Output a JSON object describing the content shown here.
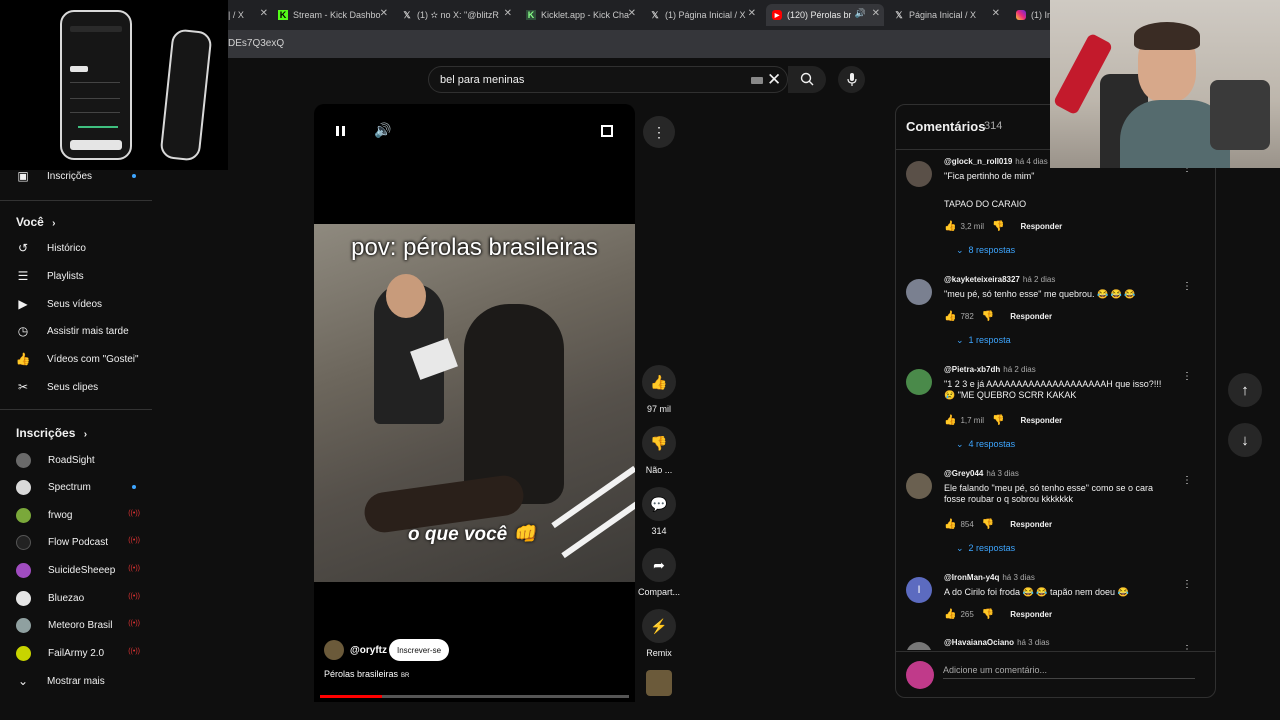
{
  "browser": {
    "tabs": [
      {
        "title": "| / X",
        "favicon": "x-icon",
        "active": false
      },
      {
        "title": "Stream - Kick Dashbo",
        "favicon": "kick-icon",
        "active": false
      },
      {
        "title": "(1) ✫ no X: \"@blitzR",
        "favicon": "x-icon",
        "active": false
      },
      {
        "title": "Kicklet.app - Kick Cha",
        "favicon": "kicklet-icon",
        "active": false
      },
      {
        "title": "(1) Página Inicial / X",
        "favicon": "x-icon",
        "active": false
      },
      {
        "title": "(120) Pérolas bra",
        "favicon": "youtube-icon",
        "active": true
      },
      {
        "title": "Página Inicial / X",
        "favicon": "x-icon",
        "active": false
      },
      {
        "title": "(1) In",
        "favicon": "instagram-icon",
        "active": false
      }
    ],
    "url_fragment": "DEs7Q3exQ"
  },
  "search": {
    "value": "bel para meninas"
  },
  "sidebar": {
    "top_item": "Inscrições",
    "voce_section": "Você",
    "voce_items": [
      {
        "label": "Histórico",
        "icon": "history-icon"
      },
      {
        "label": "Playlists",
        "icon": "playlist-icon"
      },
      {
        "label": "Seus vídeos",
        "icon": "my-videos-icon"
      },
      {
        "label": "Assistir mais tarde",
        "icon": "clock-icon"
      },
      {
        "label": "Vídeos com \"Gostei\"",
        "icon": "thumb-up-icon"
      },
      {
        "label": "Seus clipes",
        "icon": "scissors-icon"
      }
    ],
    "subs_section": "Inscrições",
    "subscriptions": [
      {
        "name": "RoadSight",
        "color": "#6a6a6a",
        "indicator": ""
      },
      {
        "name": "Spectrum",
        "color": "#d9d9d9",
        "indicator": "new"
      },
      {
        "name": "frwog",
        "color": "#7aa83a",
        "indicator": "live"
      },
      {
        "name": "Flow Podcast",
        "color": "#222222",
        "indicator": "live"
      },
      {
        "name": "SuicideSheeep",
        "color": "#a04cc0",
        "indicator": "live"
      },
      {
        "name": "Bluezao",
        "color": "#e5e5e5",
        "indicator": "live"
      },
      {
        "name": "Meteoro Brasil",
        "color": "#8fa0a0",
        "indicator": "live"
      },
      {
        "name": "FailArmy 2.0",
        "color": "#c8d400",
        "indicator": "live"
      }
    ],
    "show_more": "Mostrar mais"
  },
  "video": {
    "caption_top": "pov: pérolas brasileiras",
    "caption_bottom": "o que você 👊",
    "channel": "@oryftz",
    "subscribe_label": "Inscrever-se",
    "title": "Pérolas brasileiras",
    "title_badge": "BR",
    "progress": 0.2
  },
  "actions": {
    "like_count": "97 mil",
    "dislike_label": "Não ...",
    "comments_count": "314",
    "share_label": "Compart...",
    "remix_label": "Remix"
  },
  "comments_panel": {
    "title": "Comentários",
    "count": "314",
    "reply_label": "Responder",
    "input_placeholder": "Adicione um comentário...",
    "items": [
      {
        "author": "@glock_n_roll019",
        "time": "há 4 dias",
        "text": "\"Fica pertinho de mim\"",
        "text2": "TAPAO DO CARAIO",
        "likes": "3,2 mil",
        "replies": "8 respostas",
        "avatar_color": "#5a5048"
      },
      {
        "author": "@kayketeixeira8327",
        "time": "há 2 dias",
        "text": "\"meu pé, só tenho esse\" me quebrou. 😂 😂 😂",
        "text2": "",
        "likes": "782",
        "replies": "1 resposta",
        "avatar_color": "#7a8090"
      },
      {
        "author": "@Pietra-xb7dh",
        "time": "há 2 dias",
        "text": "\"1 2 3 e já AAAAAAAAAAAAAAAAAAAAH que isso?!!! 😢 \"ME QUEBRO SCRR KAKAK",
        "text2": "",
        "likes": "1,7 mil",
        "replies": "4 respostas",
        "avatar_color": "#4a8a4a"
      },
      {
        "author": "@Grey044",
        "time": "há 3 dias",
        "text": "Ele falando \"meu pé, só tenho esse\" como se o cara fosse roubar o q sobrou kkkkkkk",
        "text2": "",
        "likes": "854",
        "replies": "2 respostas",
        "avatar_color": "#6a6050"
      },
      {
        "author": "@IronMan-y4q",
        "time": "há 3 dias",
        "text": "A do Cirilo foi froda 😂 😂 tapão nem doeu 😂",
        "text2": "",
        "likes": "265",
        "replies": "",
        "avatar_color": "#5c6bc0",
        "avatar_letter": "I"
      },
      {
        "author": "@HavaianaOciano",
        "time": "há 3 dias",
        "text": "",
        "text2": "",
        "likes": "",
        "replies": "",
        "avatar_color": "#777777"
      }
    ]
  }
}
